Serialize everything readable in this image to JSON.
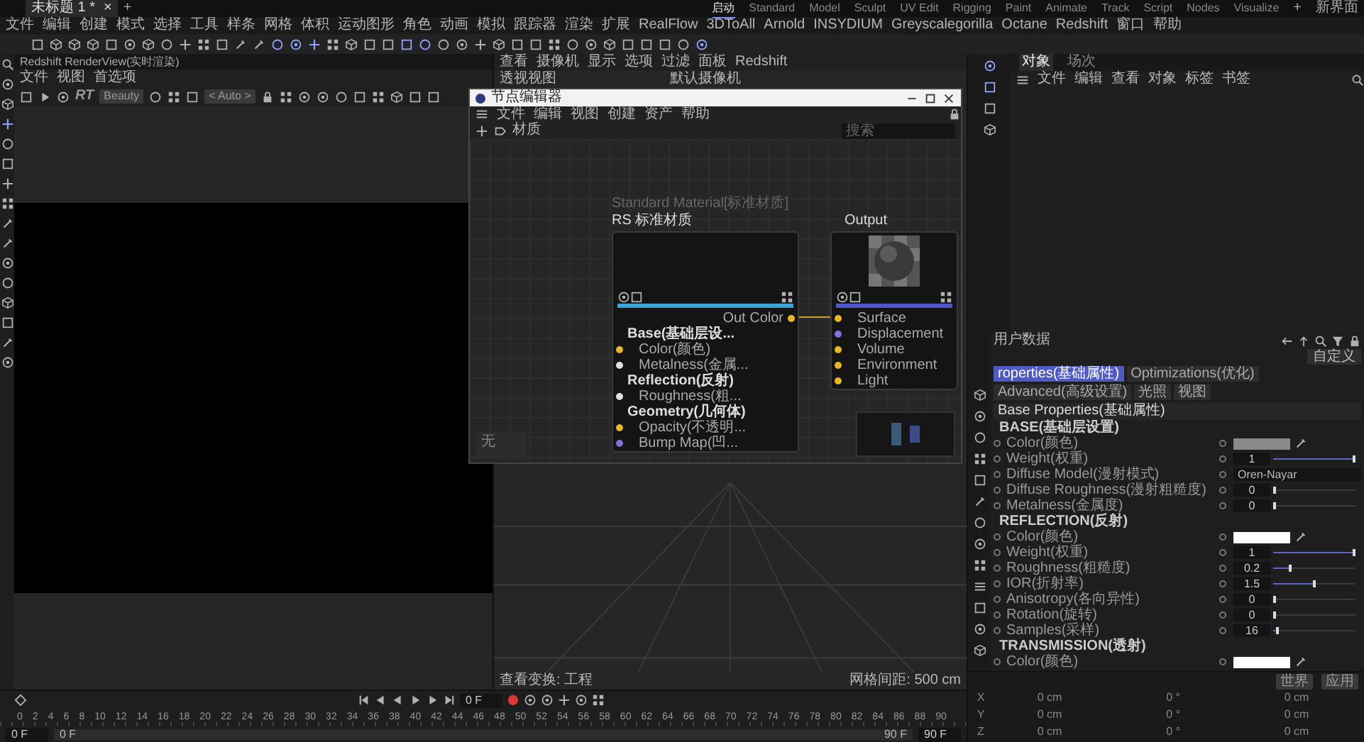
{
  "title_tab": {
    "label": "未标题 1 *",
    "close": "×",
    "add": "+"
  },
  "layouts": [
    {
      "label": "启动",
      "selected": true
    },
    {
      "label": "Standard",
      "selected": false
    },
    {
      "label": "Model",
      "selected": false
    },
    {
      "label": "Sculpt",
      "selected": false
    },
    {
      "label": "UV Edit",
      "selected": false
    },
    {
      "label": "Rigging",
      "selected": false
    },
    {
      "label": "Paint",
      "selected": false
    },
    {
      "label": "Animate",
      "selected": false
    },
    {
      "label": "Track",
      "selected": false
    },
    {
      "label": "Script",
      "selected": false
    },
    {
      "label": "Nodes",
      "selected": false
    },
    {
      "label": "Visualize",
      "selected": false
    }
  ],
  "add_layout": "+",
  "new_layout": "新界面",
  "menu": [
    "文件",
    "编辑",
    "创建",
    "模式",
    "选择",
    "工具",
    "样条",
    "网格",
    "体积",
    "运动图形",
    "角色",
    "动画",
    "模拟",
    "跟踪器",
    "渲染",
    "扩展",
    "RealFlow",
    "3DToAll",
    "Arnold",
    "INSYDIUM",
    "Greyscalegorilla",
    "Octane",
    "Redshift",
    "窗口",
    "帮助"
  ],
  "render_view": {
    "title": "Redshift RenderView(实时渲染)",
    "menu": [
      "文件",
      "视图",
      "首选项"
    ],
    "rt": "RT",
    "aov": "Beauty",
    "zoom": "< Auto >"
  },
  "viewport": {
    "menu": [
      "查看",
      "摄像机",
      "显示",
      "选项",
      "过滤",
      "面板",
      "Redshift"
    ],
    "name": "透视视图",
    "camera": "默认摄像机",
    "view_transform": "查看变换: 工程",
    "grid_spacing": "网格间距: 500 cm"
  },
  "objects": {
    "tabs": [
      {
        "label": "对象",
        "selected": true
      },
      {
        "label": "场次",
        "selected": false
      }
    ],
    "menu": [
      "文件",
      "编辑",
      "查看",
      "对象",
      "标签",
      "书签"
    ]
  },
  "node_editor": {
    "title": "节点编辑器",
    "menu": [
      "文件",
      "编辑",
      "视图",
      "创建",
      "资产",
      "帮助"
    ],
    "toolbar_label": "材质",
    "search_placeholder": "搜索",
    "status": "无",
    "nodes": [
      {
        "kind": "material",
        "caption": "Standard Material[标准材质]",
        "title": "RS 标准材质",
        "output": {
          "label": "Out Color",
          "color": "#e6b62c"
        },
        "ports": [
          {
            "label": "Base(基础层设...",
            "kind": "group"
          },
          {
            "label": "Color(颜色)",
            "kind": "port",
            "color": "#e6b62c"
          },
          {
            "label": "Metalness(金属...",
            "kind": "port",
            "color": "#e0e0e0"
          },
          {
            "label": "Reflection(反射)",
            "kind": "group"
          },
          {
            "label": "Roughness(粗...",
            "kind": "port",
            "color": "#e0e0e0"
          },
          {
            "label": "Geometry(几何体)",
            "kind": "group"
          },
          {
            "label": "Opacity(不透明...",
            "kind": "port",
            "color": "#e6b62c"
          },
          {
            "label": "Bump Map(凹...",
            "kind": "port",
            "color": "#8a6fd8"
          }
        ]
      },
      {
        "kind": "output",
        "title": "Output",
        "ports": [
          {
            "label": "Surface",
            "kind": "port",
            "color": "#e6b62c"
          },
          {
            "label": "Displacement",
            "kind": "port",
            "color": "#8a6fd8"
          },
          {
            "label": "Volume",
            "kind": "port",
            "color": "#e6b62c"
          },
          {
            "label": "Environment",
            "kind": "port",
            "color": "#e6b62c"
          },
          {
            "label": "Light",
            "kind": "port",
            "color": "#e6b62c"
          }
        ]
      }
    ]
  },
  "attributes": {
    "title": "用户数据",
    "preset": "自定义",
    "tabs": [
      {
        "label": "roperties(基础属性)",
        "selected": true
      },
      {
        "label": "Optimizations(优化)",
        "selected": false
      },
      {
        "label": "Advanced(高级设置)",
        "selected": false
      },
      {
        "label": "光照",
        "selected": false
      },
      {
        "label": "视图",
        "selected": false
      }
    ],
    "section": "Base Properties(基础属性)",
    "groups": [
      {
        "title": "BASE(基础层设置)",
        "rows": [
          {
            "label": "Color(颜色)",
            "kind": "color",
            "color": "#8a8a8a"
          },
          {
            "label": "Weight(权重)",
            "kind": "slider",
            "value": "1",
            "level": 1
          },
          {
            "label": "Diffuse Model(漫射模式)",
            "kind": "dropdown",
            "value": "Oren-Nayar"
          },
          {
            "label": "Diffuse Roughness(漫射粗糙度)",
            "kind": "slider",
            "value": "0",
            "level": 0
          },
          {
            "label": "Metalness(金属度)",
            "kind": "slider",
            "value": "0",
            "level": 0
          }
        ]
      },
      {
        "title": "REFLECTION(反射)",
        "rows": [
          {
            "label": "Color(颜色)",
            "kind": "color",
            "color": "#ffffff"
          },
          {
            "label": "Weight(权重)",
            "kind": "slider",
            "value": "1",
            "level": 1
          },
          {
            "label": "Roughness(粗糙度)",
            "kind": "slider",
            "value": "0.2",
            "level": 0.2
          },
          {
            "label": "IOR(折射率)",
            "kind": "slider",
            "value": "1.5",
            "level": 0.5
          },
          {
            "label": "Anisotropy(各向异性)",
            "kind": "slider",
            "value": "0",
            "level": 0
          },
          {
            "label": "Rotation(旋转)",
            "kind": "slider",
            "value": "0",
            "level": 0
          },
          {
            "label": "Samples(采样)",
            "kind": "slider",
            "value": "16",
            "level": 0.03
          }
        ]
      },
      {
        "title": "TRANSMISSION(透射)",
        "rows": [
          {
            "label": "Color(颜色)",
            "kind": "color",
            "color": "#ffffff"
          }
        ]
      }
    ]
  },
  "coordinates": {
    "mode": "世界",
    "apply": "应用",
    "rows": [
      {
        "axis": "X",
        "position": "0 cm",
        "rotation": "0 °",
        "scale": "0 cm"
      },
      {
        "axis": "Y",
        "position": "0 cm",
        "rotation": "0 °",
        "scale": "0 cm"
      },
      {
        "axis": "Z",
        "position": "0 cm",
        "rotation": "0 °",
        "scale": "0 cm"
      }
    ]
  },
  "timeline": {
    "frame": "0 F",
    "start": "0 F",
    "preview_start": "0 F",
    "preview_end": "90 F",
    "end": "90 F",
    "ticks": [
      "0",
      "2",
      "4",
      "6",
      "8",
      "10",
      "12",
      "14",
      "16",
      "18",
      "20",
      "22",
      "24",
      "26",
      "28",
      "30",
      "32",
      "34",
      "36",
      "38",
      "40",
      "42",
      "44",
      "46",
      "48",
      "50",
      "52",
      "54",
      "56",
      "58",
      "60",
      "62",
      "64",
      "66",
      "68",
      "70",
      "72",
      "74",
      "76",
      "78",
      "80",
      "82",
      "84",
      "86",
      "88",
      "90"
    ]
  }
}
